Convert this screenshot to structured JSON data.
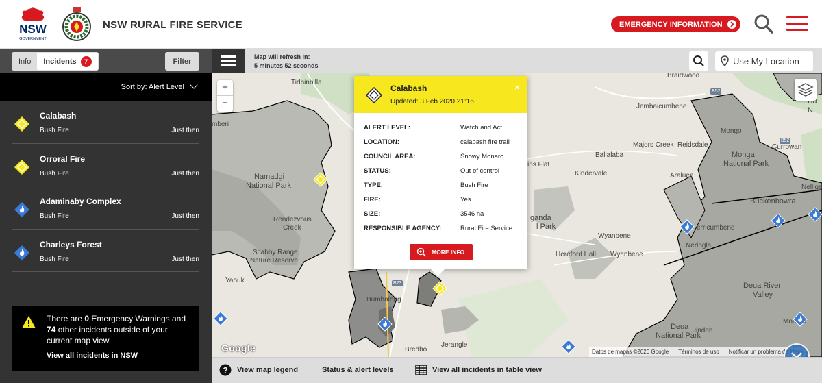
{
  "header": {
    "nsw_text": "NSW",
    "gov_text": "GOVERNMENT",
    "title": "NSW RURAL FIRE SERVICE",
    "emergency_label": "EMERGENCY INFORMATION",
    "brand_color": "#d71920"
  },
  "sidebar": {
    "tab_info": "Info",
    "tab_incidents": "Incidents",
    "incident_count": "7",
    "filter_label": "Filter",
    "sort_label": "Sort by: Alert Level",
    "incidents": [
      {
        "name": "Calabash",
        "type": "Bush Fire",
        "time": "Just then",
        "level": "watch-and-act",
        "icon": "yellow-diamond-icon"
      },
      {
        "name": "Orroral Fire",
        "type": "Bush Fire",
        "time": "Just then",
        "level": "watch-and-act",
        "icon": "yellow-diamond-icon"
      },
      {
        "name": "Adaminaby Complex",
        "type": "Bush Fire",
        "time": "Just then",
        "level": "advice",
        "icon": "blue-fire-diamond-icon"
      },
      {
        "name": "Charleys Forest",
        "type": "Bush Fire",
        "time": "Just then",
        "level": "advice",
        "icon": "blue-fire-diamond-icon"
      }
    ],
    "warning": {
      "part1": "There are ",
      "emergency_count": "0",
      "part2": " Emergency Warnings and ",
      "other_count": "74",
      "part3": " other incidents outside of your current map view.",
      "link": "View all incidents in NSW"
    }
  },
  "map_toolbar": {
    "refresh_line1": "Map will refresh in:",
    "refresh_line2": "5 minutes 52 seconds",
    "location_label": "Use My Location"
  },
  "map": {
    "places": {
      "tidbinbilla": "Tidbinbilla",
      "mberi": "mberi",
      "namadgi1": "Namadgi",
      "namadgi2": "National Park",
      "rendezvous1": "Rendezvous",
      "rendezvous2": "Creek",
      "scabby1": "Scabby Range",
      "scabby2": "Nature Reserve",
      "yaouk": "Yaouk",
      "bumbalong": "Bumbalong",
      "bredbo": "Bredbo",
      "jerangle": "Jerangle",
      "braidwood": "Braidwood",
      "jembaicumbene": "Jembaicumbene",
      "majors_creek": "Majors Creek",
      "ballalaba": "Ballalaba",
      "kindervale": "Kindervale",
      "plains_flat": "ins Flat",
      "anda1": "ganda",
      "anda2": "l Park",
      "hereford": "Hereford Hall",
      "wyanbene": "Wyanbene",
      "reidsdale": "Reidsdale",
      "araluen": "Araluen",
      "mongo": "Mongo",
      "monga1": "Monga",
      "monga2": "National Park",
      "currowan": "Currowan",
      "buckenbowra": "Buckenbowra",
      "nelligen": "Nellige",
      "merricumbene": "erricumbene",
      "neringla": "Neringla",
      "deua_valley1": "Deua River",
      "deua_valley2": "Valley",
      "deua_np1": "Deua",
      "deua_np2": "National Park",
      "moruya": "Moruya",
      "jinden": "Jinden",
      "budawang1": "Bu",
      "budawang2": "N"
    },
    "roads": {
      "b52a": "B52",
      "b52b": "B52",
      "b23": "B23"
    },
    "google": "Google",
    "attribution": [
      "Datos de mapas ©2020 Google",
      "Términos de uso",
      "Notificar un problema de Maps"
    ]
  },
  "popup": {
    "name": "Calabash",
    "updated": "Updated: 3 Feb 2020 21:16",
    "close": "×",
    "rows": [
      {
        "k": "ALERT LEVEL:",
        "v": "Watch and Act"
      },
      {
        "k": "LOCATION:",
        "v": "calabash fire trail"
      },
      {
        "k": "COUNCIL AREA:",
        "v": "Snowy Monaro"
      },
      {
        "k": "STATUS:",
        "v": "Out of control"
      },
      {
        "k": "TYPE:",
        "v": "Bush Fire"
      },
      {
        "k": "FIRE:",
        "v": "Yes"
      },
      {
        "k": "SIZE:",
        "v": "3546 ha"
      },
      {
        "k": "RESPONSIBLE AGENCY:",
        "v": "Rural Fire Service"
      }
    ],
    "more_info": "MORE INFO",
    "header_color": "#f6e71e"
  },
  "bottom": {
    "legend": "View map legend",
    "status": "Status & alert levels",
    "table": "View all incidents in table view"
  }
}
